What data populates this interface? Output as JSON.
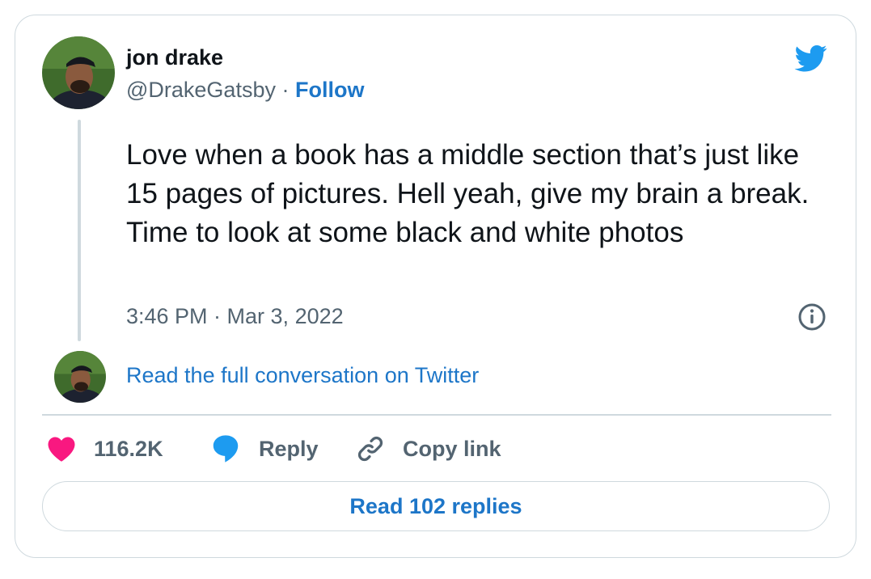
{
  "author": {
    "name": "jon drake",
    "handle": "@DrakeGatsby",
    "separator": " · ",
    "follow_label": "Follow"
  },
  "tweet": {
    "text": "Love when a book has a middle section that’s just like 15 pages of pictures. Hell yeah, give my brain a break. Time to look at some black and white photos",
    "timestamp": "3:46 PM · Mar 3, 2022"
  },
  "conversation_link": "Read the full conversation on Twitter",
  "actions": {
    "like_count": "116.2K",
    "reply_label": "Reply",
    "copy_link_label": "Copy link"
  },
  "read_replies_label": "Read 102 replies",
  "colors": {
    "link_blue": "#1d76c8",
    "twitter_blue": "#1d9bf0",
    "heart_pink": "#f91880",
    "muted_text": "#536471",
    "border": "#cfd9de"
  },
  "icons": [
    "twitter-bird-icon",
    "info-icon",
    "heart-icon",
    "reply-bubble-icon",
    "link-icon"
  ]
}
